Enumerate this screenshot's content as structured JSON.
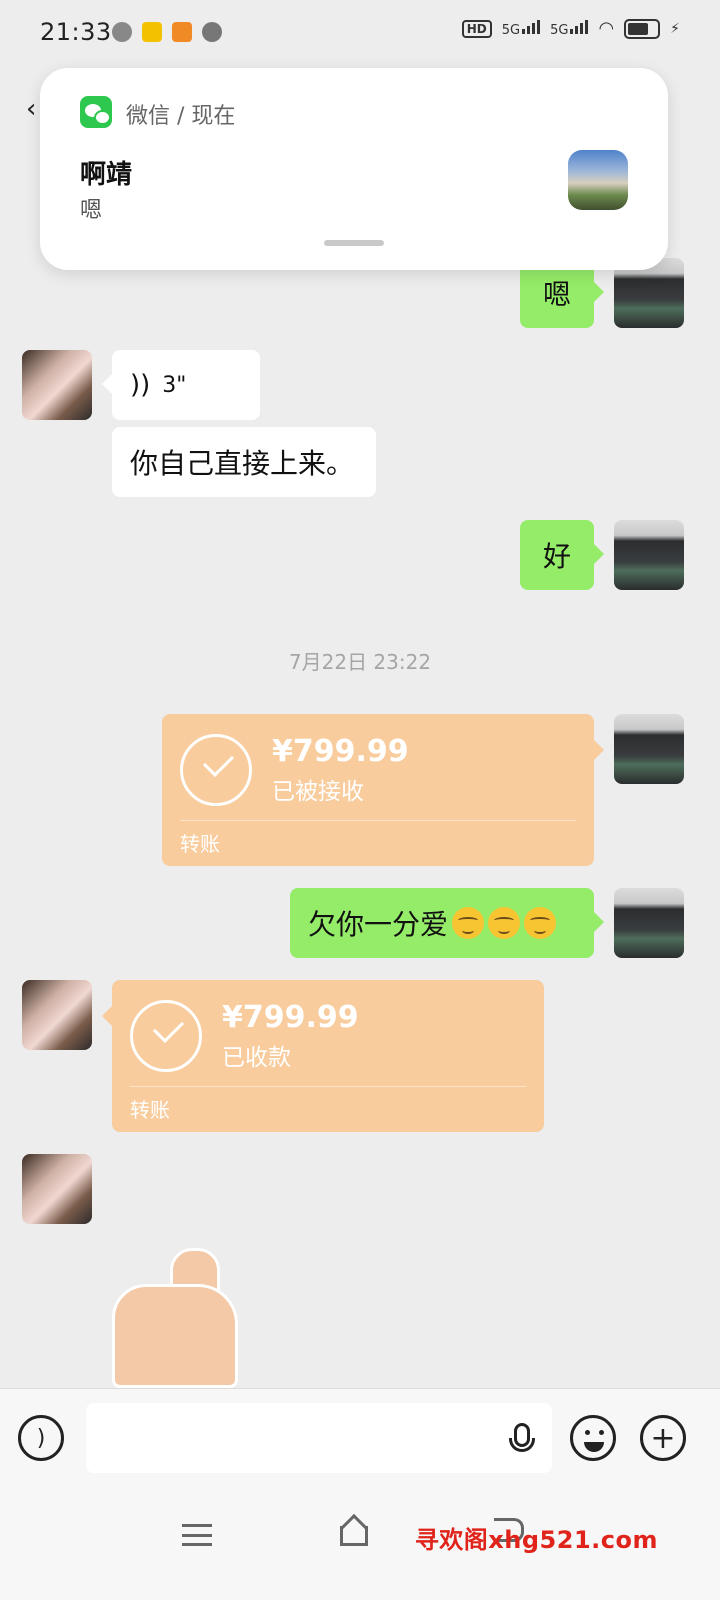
{
  "status_bar": {
    "time": "21:33",
    "hd": "HD",
    "sim1": "5G",
    "sim2": "5G"
  },
  "notification": {
    "app": "微信 / 现在",
    "sender": "啊靖",
    "message": "嗯",
    "icon": "wechat-logo"
  },
  "messages": {
    "m1": "嗯",
    "voice": "3\"",
    "m2": "你自己直接上来。",
    "m3": "好",
    "timestamp": "7月22日 23:22",
    "transfer_sent": {
      "amount": "¥799.99",
      "status": "已被接收",
      "label": "转账"
    },
    "m4": "欠你一分爱",
    "transfer_received": {
      "amount": "¥799.99",
      "status": "已收款",
      "label": "转账"
    }
  },
  "input": {
    "value": "",
    "placeholder": ""
  },
  "watermark": "寻欢阁xhg521.com",
  "colors": {
    "outgoing_bubble": "#95ec69",
    "incoming_bubble": "#ffffff",
    "transfer_card": "#f9cc9d",
    "background": "#ededed",
    "watermark": "#e0241b"
  }
}
